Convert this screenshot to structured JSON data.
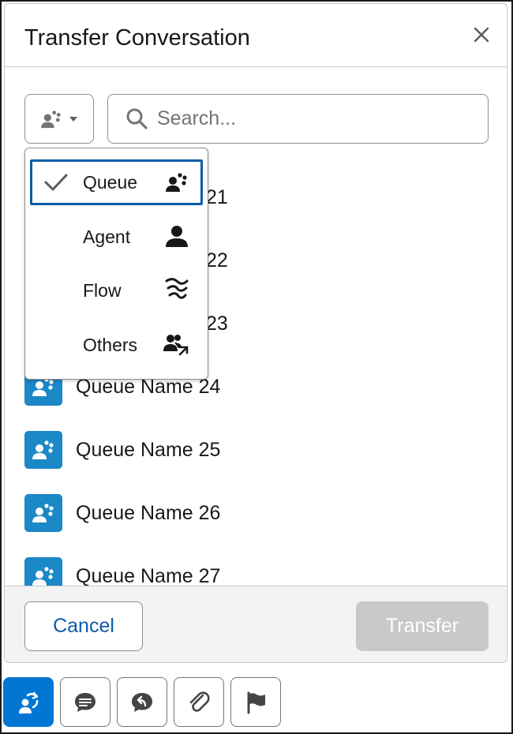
{
  "modal": {
    "title": "Transfer Conversation"
  },
  "search": {
    "placeholder": "Search..."
  },
  "type_dropdown": {
    "items": [
      {
        "label": "Queue",
        "icon": "queue-icon",
        "selected": true
      },
      {
        "label": "Agent",
        "icon": "agent-icon",
        "selected": false
      },
      {
        "label": "Flow",
        "icon": "flow-icon",
        "selected": false
      },
      {
        "label": "Others",
        "icon": "others-icon",
        "selected": false
      }
    ]
  },
  "list": {
    "items": [
      {
        "label": "21"
      },
      {
        "label": "22"
      },
      {
        "label": "23"
      },
      {
        "label": "Queue Name 24"
      },
      {
        "label": "Queue Name 25"
      },
      {
        "label": "Queue Name 26"
      },
      {
        "label": "Queue Name 27"
      }
    ]
  },
  "footer": {
    "cancel_label": "Cancel",
    "transfer_label": "Transfer"
  },
  "toolbar": {
    "buttons": [
      {
        "icon": "transfer-icon",
        "active": true
      },
      {
        "icon": "chat-icon",
        "active": false
      },
      {
        "icon": "quick-reply-icon",
        "active": false
      },
      {
        "icon": "attachment-icon",
        "active": false
      },
      {
        "icon": "flag-icon",
        "active": false
      }
    ]
  },
  "colors": {
    "brand": "#0176d3",
    "selection_border": "#0b5cab",
    "queue_tile": "#1b88c7",
    "disabled_button": "#c9c9c9"
  }
}
